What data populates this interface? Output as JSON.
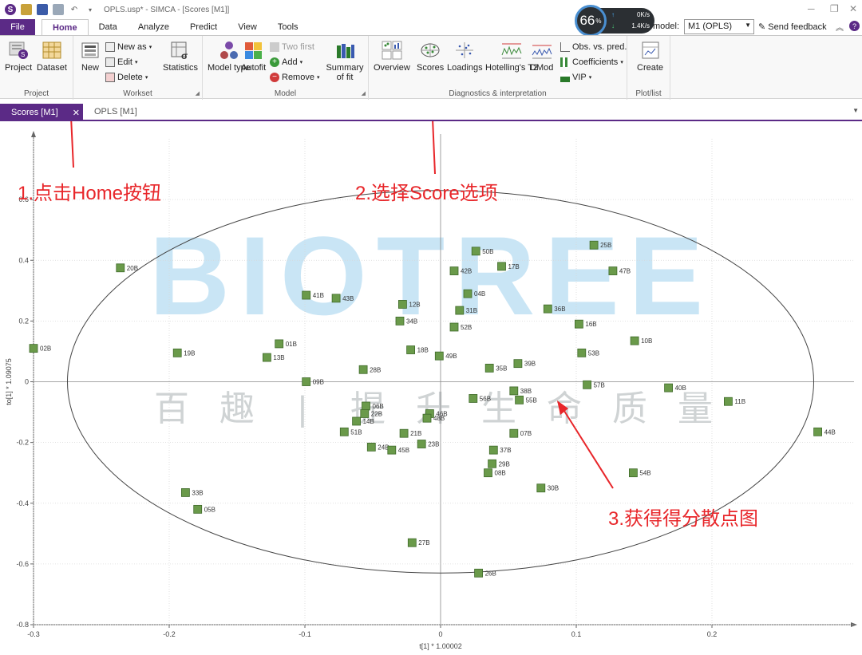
{
  "window": {
    "title": "OPLS.usp* - SIMCA - [Scores [M1]]",
    "min_glyph": "─",
    "restore_glyph": "❐",
    "close_glyph": "✕"
  },
  "menu": {
    "file": "File",
    "tabs": [
      "Home",
      "Data",
      "Analyze",
      "Predict",
      "View",
      "Tools"
    ]
  },
  "speed": {
    "percent": "66",
    "percent_unit": "%",
    "upload": "0K/s",
    "download": "1.4K/s"
  },
  "model_selector": {
    "label": "model:",
    "value": "M1 (OPLS)"
  },
  "feedback": "Send feedback",
  "ribbon": {
    "project": {
      "label": "Project",
      "buttons": [
        "Project",
        "Dataset"
      ]
    },
    "workset": {
      "label": "Workset",
      "new": "New",
      "new_as": "New as",
      "edit": "Edit",
      "delete": "Delete",
      "statistics": "Statistics"
    },
    "model": {
      "label": "Model",
      "model_type": "Model type",
      "autofit": "Autofit",
      "two_first": "Two first",
      "add": "Add",
      "remove": "Remove",
      "summary_of_fit": "Summary of fit"
    },
    "diagnostics": {
      "label": "Diagnostics & interpretation",
      "overview": "Overview",
      "scores": "Scores",
      "loadings": "Loadings",
      "hotellings": "Hotelling's T2",
      "dmod": "DMod",
      "obs_vs_pred": "Obs. vs. pred.",
      "coefficients": "Coefficients",
      "vip": "VIP"
    },
    "plotlist": {
      "label": "Plot/list",
      "create": "Create"
    }
  },
  "doc_tabs": {
    "active": "Scores [M1]",
    "inactive": "OPLS [M1]"
  },
  "annotations": {
    "step1": "1.点击Home按钮",
    "step2": "2.选择Score选项",
    "step3": "3.获得得分散点图"
  },
  "watermark": {
    "brand": "BIOTREE",
    "slogan": [
      "百",
      "趣",
      "|",
      "提",
      "升",
      "生",
      "命",
      "质",
      "量"
    ]
  },
  "colors": {
    "accent": "#5b2a86",
    "point": "#6a9a4a",
    "annotation": "#e8262a",
    "watermark_blue": "#b7ddf2",
    "watermark_gray": "#cfd3d4"
  },
  "chart_data": {
    "type": "scatter",
    "xlabel": "t[1] * 1.00002",
    "ylabel": "to[1] * 1.09075",
    "xlim": [
      -0.3,
      0.3
    ],
    "ylim": [
      -0.8,
      0.8
    ],
    "x_ticks": [
      "-0.3",
      "-0.2",
      "-0.1",
      "0",
      "0.1",
      "0.2"
    ],
    "y_ticks": [
      "-0.8",
      "-0.6",
      "-0.4",
      "-0.2",
      "0",
      "0.2",
      "0.4",
      "0.6"
    ],
    "ellipse": {
      "rx": 0.275,
      "ry": 0.63
    },
    "points": [
      {
        "label": "25B",
        "x": 0.113,
        "y": 0.45
      },
      {
        "label": "50B",
        "x": 0.026,
        "y": 0.43
      },
      {
        "label": "17B",
        "x": 0.045,
        "y": 0.38
      },
      {
        "label": "47B",
        "x": 0.127,
        "y": 0.365
      },
      {
        "label": "42B",
        "x": 0.01,
        "y": 0.365
      },
      {
        "label": "20B",
        "x": -0.236,
        "y": 0.375
      },
      {
        "label": "04B",
        "x": 0.02,
        "y": 0.29
      },
      {
        "label": "41B",
        "x": -0.099,
        "y": 0.285
      },
      {
        "label": "43B",
        "x": -0.077,
        "y": 0.275
      },
      {
        "label": "12B",
        "x": -0.028,
        "y": 0.255
      },
      {
        "label": "36B",
        "x": 0.079,
        "y": 0.24
      },
      {
        "label": "31B",
        "x": 0.014,
        "y": 0.235
      },
      {
        "label": "34B",
        "x": -0.03,
        "y": 0.2
      },
      {
        "label": "16B",
        "x": 0.102,
        "y": 0.19
      },
      {
        "label": "52B",
        "x": 0.01,
        "y": 0.18
      },
      {
        "label": "10B",
        "x": 0.143,
        "y": 0.135
      },
      {
        "label": "01B",
        "x": -0.119,
        "y": 0.125
      },
      {
        "label": "02B",
        "x": -0.3,
        "y": 0.11
      },
      {
        "label": "18B",
        "x": -0.022,
        "y": 0.105
      },
      {
        "label": "53B",
        "x": 0.104,
        "y": 0.095
      },
      {
        "label": "19B",
        "x": -0.194,
        "y": 0.095
      },
      {
        "label": "49B",
        "x": -0.001,
        "y": 0.085
      },
      {
        "label": "13B",
        "x": -0.128,
        "y": 0.08
      },
      {
        "label": "39B",
        "x": 0.057,
        "y": 0.06
      },
      {
        "label": "35B",
        "x": 0.036,
        "y": 0.045
      },
      {
        "label": "28B",
        "x": -0.057,
        "y": 0.04
      },
      {
        "label": "09B",
        "x": -0.099,
        "y": 0.0
      },
      {
        "label": "57B",
        "x": 0.108,
        "y": -0.01
      },
      {
        "label": "40B",
        "x": 0.168,
        "y": -0.02
      },
      {
        "label": "38B",
        "x": 0.054,
        "y": -0.03
      },
      {
        "label": "56B",
        "x": 0.024,
        "y": -0.055
      },
      {
        "label": "55B",
        "x": 0.058,
        "y": -0.06
      },
      {
        "label": "11B",
        "x": 0.212,
        "y": -0.065
      },
      {
        "label": "06B",
        "x": -0.055,
        "y": -0.08
      },
      {
        "label": "22B",
        "x": -0.056,
        "y": -0.105
      },
      {
        "label": "46B",
        "x": -0.008,
        "y": -0.105
      },
      {
        "label": "48B",
        "x": -0.01,
        "y": -0.12
      },
      {
        "label": "14B",
        "x": -0.062,
        "y": -0.13
      },
      {
        "label": "07B",
        "x": 0.054,
        "y": -0.17
      },
      {
        "label": "51B",
        "x": -0.071,
        "y": -0.165
      },
      {
        "label": "21B",
        "x": -0.027,
        "y": -0.17
      },
      {
        "label": "44B",
        "x": 0.278,
        "y": -0.165
      },
      {
        "label": "23B",
        "x": -0.014,
        "y": -0.205
      },
      {
        "label": "24B",
        "x": -0.051,
        "y": -0.215
      },
      {
        "label": "45B",
        "x": -0.036,
        "y": -0.225
      },
      {
        "label": "37B",
        "x": 0.039,
        "y": -0.225
      },
      {
        "label": "29B",
        "x": 0.038,
        "y": -0.27
      },
      {
        "label": "08B",
        "x": 0.035,
        "y": -0.3
      },
      {
        "label": "54B",
        "x": 0.142,
        "y": -0.3
      },
      {
        "label": "30B",
        "x": 0.074,
        "y": -0.35
      },
      {
        "label": "33B",
        "x": -0.188,
        "y": -0.365
      },
      {
        "label": "05B",
        "x": -0.179,
        "y": -0.42
      },
      {
        "label": "27B",
        "x": -0.021,
        "y": -0.53
      },
      {
        "label": "26B",
        "x": 0.028,
        "y": -0.63
      }
    ]
  }
}
